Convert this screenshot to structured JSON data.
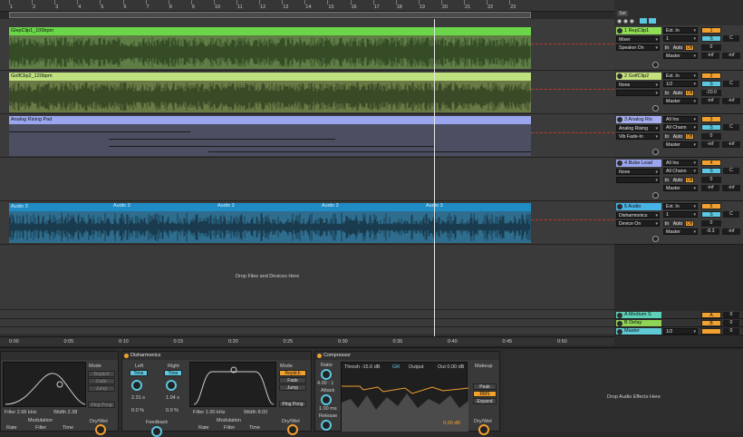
{
  "ruler": {
    "bars": [
      "1",
      "2",
      "3",
      "4",
      "5",
      "6",
      "7",
      "8",
      "9",
      "10",
      "11",
      "12",
      "13",
      "14",
      "15",
      "16",
      "17",
      "18",
      "19",
      "20",
      "21",
      "22",
      "23"
    ]
  },
  "tracks": [
    {
      "clip_name": "GlepClip1_100bpm",
      "clip_color": "#6bd64a",
      "body_color": "#5f7e46",
      "track_name": "1 RepClip1",
      "input": "Ext. In",
      "ch": "1",
      "mon_sel": "Mixer",
      "device_sel": "Speaker On",
      "out": "Master",
      "num": "1",
      "vol": "0",
      "pan": "C",
      "vol2": "-inf",
      "vol3": "-inf",
      "tname_color": "#8fdc55"
    },
    {
      "clip_name": "GolfClip2_120bpm",
      "clip_color": "#bfe07f",
      "body_color": "#6b7a45",
      "track_name": "2 GolfClip2",
      "input": "Ext. In",
      "ch": "1/2",
      "mon_sel": "None",
      "device_sel": "",
      "out": "Master",
      "num": "2",
      "vol": "-20.0",
      "pan": "C",
      "vol2": "-inf",
      "vol3": "-inf",
      "tname_color": "#c6e27e"
    },
    {
      "clip_name": "Analog Rising Pad",
      "clip_color": "#9aa6ef",
      "body_color": "#4c4e62",
      "track_name": "3 Analog Ris",
      "input": "All Ins",
      "ch": "All Chann",
      "mon_sel": "Analog Rising",
      "device_sel": "Vib Fade-In",
      "out": "Master",
      "num": "3",
      "vol": "0",
      "pan": "C",
      "vol2": "-inf",
      "vol3": "-inf",
      "tname_color": "#a6aef0"
    },
    {
      "clip_name": "",
      "clip_color": "#9aa6ef",
      "body_color": "#3b3b3b",
      "track_name": "4 Bube Lead",
      "input": "All Ins",
      "ch": "All Chann",
      "mon_sel": "None",
      "device_sel": "",
      "out": "Master",
      "num": "4",
      "vol": "0",
      "pan": "C",
      "vol2": "-inf",
      "vol3": "-inf",
      "tname_color": "#9aa6ef"
    },
    {
      "clip_name": "Audio 3",
      "clip_color": "#1f8cc6",
      "body_color": "#2e6d8e",
      "track_name": "5 Audio",
      "input": "Ext. In",
      "ch": "1",
      "mon_sel": "Disharmonics",
      "device_sel": "Device On",
      "out": "Master",
      "num": "5",
      "vol": "0",
      "pan": "C",
      "vol2": "-8.3",
      "vol3": "-inf",
      "tname_color": "#47b3e6"
    }
  ],
  "audio_subclips": [
    "Audio 3",
    "Audio 3",
    "Audio 3",
    "Audio 3"
  ],
  "returns": [
    {
      "name": "A Medium S",
      "letter": "A",
      "vol": "0"
    },
    {
      "name": "B Delay",
      "letter": "B",
      "vol": "0"
    },
    {
      "name": "Master",
      "letter": "",
      "vol": "0",
      "ch": "1/2"
    }
  ],
  "mixer_header": {
    "set_label": "Set"
  },
  "drop_files": "Drop Files and Devices Here",
  "drop_audio_effects": "Drop Audio Effects Here",
  "timeline": [
    "0:00",
    "0:05",
    "0:10",
    "0:15",
    "0:20",
    "0:25",
    "0:30",
    "0:35",
    "0:40",
    "0:45",
    "0:50"
  ],
  "autofilter": {
    "mode_label": "Mode",
    "modes": [
      "Repitch",
      "Fade",
      "Jump"
    ],
    "filter": "Filter 2.66 kHz",
    "width": "Width 2.38",
    "modulation": "Modulation",
    "rate": "Rate",
    "filter2": "Filter",
    "time": "Time",
    "ping_pong": "Ping Pong",
    "dry_wet": "Dry/Wet"
  },
  "disharmonics": {
    "title": "Disharmonics",
    "left": "Left",
    "right": "Right",
    "time": "Time",
    "left_val": "2.31 s",
    "right_val": "1.04 s",
    "left_pct": "0.0 %",
    "right_pct": "0.0 %",
    "feedback": "Feedback",
    "filter": "Filter 1.00 kHz",
    "width": "Width 8.00",
    "modulation": "Modulation",
    "rate": "Rate",
    "filter2": "Filter",
    "time2": "Time",
    "mode_label": "Mode",
    "modes": [
      "Repitch",
      "Fade",
      "Jump"
    ],
    "ping_pong": "Ping Pong",
    "dry_wet": "Dry/Wet"
  },
  "compressor": {
    "title": "Compressor",
    "ratio": "Ratio",
    "ratio_val": "4.00 : 1",
    "attack": "Attack",
    "attack_val": "1.00 ms",
    "release": "Release",
    "thresh": "Thresh -15.6 dB",
    "gr": "GR",
    "output": "Output",
    "out": "Out 0.00 dB",
    "makeup": "Makeup",
    "peak": "Peak",
    "rms": "RMS",
    "expand": "Expand",
    "gain_val": "0.00 dB",
    "dry_wet": "Dry/Wet"
  }
}
